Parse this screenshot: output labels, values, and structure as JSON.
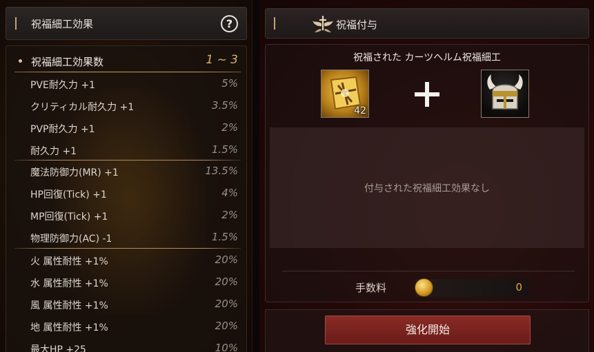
{
  "left_panel": {
    "title": "祝福細工効果",
    "help_icon": "?",
    "effect_count": {
      "label": "祝福細工効果数",
      "value": "1 ~ 3"
    },
    "effects": [
      {
        "label": "PVE耐久力 +1",
        "value": "5%"
      },
      {
        "label": "クリティカル耐久力 +1",
        "value": "3.5%"
      },
      {
        "label": "PVP耐久力 +1",
        "value": "2%"
      },
      {
        "label": "耐久力 +1",
        "value": "1.5%"
      },
      {
        "label": "魔法防御力(MR) +1",
        "value": "13.5%"
      },
      {
        "label": "HP回復(Tick) +1",
        "value": "4%"
      },
      {
        "label": "MP回復(Tick) +1",
        "value": "2%"
      },
      {
        "label": "物理防御力(AC) -1",
        "value": "1.5%"
      },
      {
        "label": "火 属性耐性 +1%",
        "value": "20%"
      },
      {
        "label": "水 属性耐性 +1%",
        "value": "20%"
      },
      {
        "label": "風 属性耐性 +1%",
        "value": "20%"
      },
      {
        "label": "地 属性耐性 +1%",
        "value": "20%"
      },
      {
        "label": "最大HP +25",
        "value": "10%"
      }
    ]
  },
  "right_panel": {
    "title": "祝福付与",
    "emblem_icon": "blessing-emblem-icon",
    "item_name": "祝福された カーツヘルム祝福細工",
    "scroll_slot": {
      "icon": "blessing-scroll-icon",
      "count": "42"
    },
    "helm_slot": {
      "icon": "horned-helm-icon"
    },
    "effect_message": "付与された祝福細工効果なし",
    "fee": {
      "label": "手数料",
      "value": "0",
      "icon": "gold-coin-icon"
    },
    "start_button": "強化開始"
  },
  "colors": {
    "accent_gold": "#d9b06a",
    "button_red": "#7a221e",
    "fee_value": "#e9a545"
  }
}
